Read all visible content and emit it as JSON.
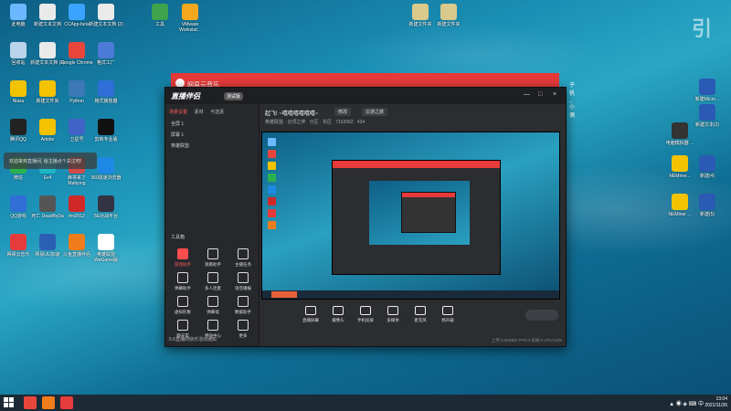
{
  "desktop": {
    "left_icons": [
      {
        "label": "此电脑",
        "color": "#6bb8ff"
      },
      {
        "label": "新建文本文档",
        "color": "#eaeaea"
      },
      {
        "label": "CCApp-beta",
        "color": "#3aa3ff"
      },
      {
        "label": "新建文本文档 (2)",
        "color": "#eaeaea"
      },
      {
        "label": "回收站",
        "color": "#b9d4ea"
      },
      {
        "label": "新建文本文档 (2)",
        "color": "#eaeaea"
      },
      {
        "label": "Google Chrome",
        "color": "#e9463b"
      },
      {
        "label": "格式工厂",
        "color": "#4b7bd6"
      },
      {
        "label": "Nlasu",
        "color": "#f3c200"
      },
      {
        "label": "新建文件夹",
        "color": "#f3c200"
      },
      {
        "label": "Python",
        "color": "#3b78b5"
      },
      {
        "label": "格式播放器",
        "color": "#2e6ed6"
      },
      {
        "label": "腾讯QQ",
        "color": "#222"
      },
      {
        "label": "Adobe",
        "color": "#f3c200"
      },
      {
        "label": "卫星号",
        "color": "#4063c7"
      },
      {
        "label": "剪映专业版",
        "color": "#111"
      },
      {
        "label": "微信",
        "color": "#2bb24c"
      },
      {
        "label": "Ev4",
        "color": "#1db7c6"
      },
      {
        "label": "麻将来了 Mahjong",
        "color": "#d24a4a"
      },
      {
        "label": "360极速浏览器",
        "color": "#1e88e5"
      },
      {
        "label": "QQ游戏",
        "color": "#2f6fd6"
      },
      {
        "label": "死亡 DeadByDa",
        "color": "#555"
      },
      {
        "label": "fmi2012",
        "color": "#d02828"
      },
      {
        "label": "5E对战平台",
        "color": "#334"
      },
      {
        "label": "网易云音乐",
        "color": "#e63b3b"
      },
      {
        "label": "网易UU加速",
        "color": "#2b5fb3"
      },
      {
        "label": "斗鱼直播伴侣",
        "color": "#f07c1b"
      },
      {
        "label": "英雄联盟 WeGame版",
        "color": "#ffffff"
      }
    ],
    "top_icons": [
      {
        "label": "工具",
        "color": "#3fa34d"
      },
      {
        "label": "VMware Workstat...",
        "color": "#f4a81d"
      },
      {
        "label": "新建文件夹",
        "color": "#d9c98a"
      },
      {
        "label": "新建文件夹",
        "color": "#d9c98a"
      }
    ],
    "right_icons": [
      {
        "label": "新建Micro...",
        "color": "#2a5ab3"
      },
      {
        "label": "新建文本(2)",
        "color": "#2a5ab3"
      },
      {
        "label": "电脑模拟器 ...",
        "color": "#333"
      },
      {
        "label": "新建(4)",
        "color": "#2a5ab3"
      },
      {
        "label": "NEMiner...",
        "color": "#f3c200"
      },
      {
        "label": "新建(5)",
        "color": "#2a5ab3"
      },
      {
        "label": "NEMiner ...",
        "color": "#f3c200"
      }
    ],
    "watermark_big": "引",
    "watermark_small": ""
  },
  "music_window": {
    "title": "网易云音乐",
    "user": "子帆_小偶"
  },
  "app": {
    "brand": "直播伴侣",
    "brand_tag": "测试版",
    "window_controls": [
      "—",
      "□",
      "×"
    ],
    "tabs": [
      "场景设置",
      "素材",
      "可选素"
    ],
    "scenes": [
      "全屏 1",
      "屏幕 1",
      "英雄联盟"
    ],
    "tools_title": "工具箱",
    "tools": [
      {
        "label": "游戏助手",
        "red": true
      },
      {
        "label": "观看助手",
        "red": false
      },
      {
        "label": "主播任务",
        "red": false
      },
      {
        "label": "弹幕助手",
        "red": false
      },
      {
        "label": "多人连麦",
        "red": false
      },
      {
        "label": "语音播报",
        "red": false
      },
      {
        "label": "虚拟形象",
        "red": false
      },
      {
        "label": "弹幕墙",
        "red": false
      },
      {
        "label": "数据助手",
        "red": false
      },
      {
        "label": "聊天室",
        "red": false
      },
      {
        "label": "特效中心",
        "red": false
      },
      {
        "label": "更多",
        "red": false
      }
    ],
    "status_text": "5.6直播间快乐活动通知",
    "header": {
      "title": "起飞! ~嘻嘻嘻嘻嘻嘻~",
      "badge1": "修改",
      "badge2": "云游之旅",
      "sub1": "英雄联盟 · 云顶之弈",
      "sub2": "分区 · 东区",
      "room": "7162062",
      "count": "434"
    },
    "controls": [
      "直播屏幕",
      "摄像头",
      "手机投屏",
      "多媒体",
      "麦克风",
      "扬声器"
    ],
    "go_live": "",
    "info": "上传:0.00KB/s  FPS:0  丢帧:0  CPU:12%"
  },
  "chat_overlay": {
    "text": "欢迎来到直播间, 给主播点个关注吧!"
  },
  "taskbar": {
    "tray": "▲ ◉ ◈ ⌨ 中",
    "time": "13:04",
    "date": "2021/11/26"
  }
}
